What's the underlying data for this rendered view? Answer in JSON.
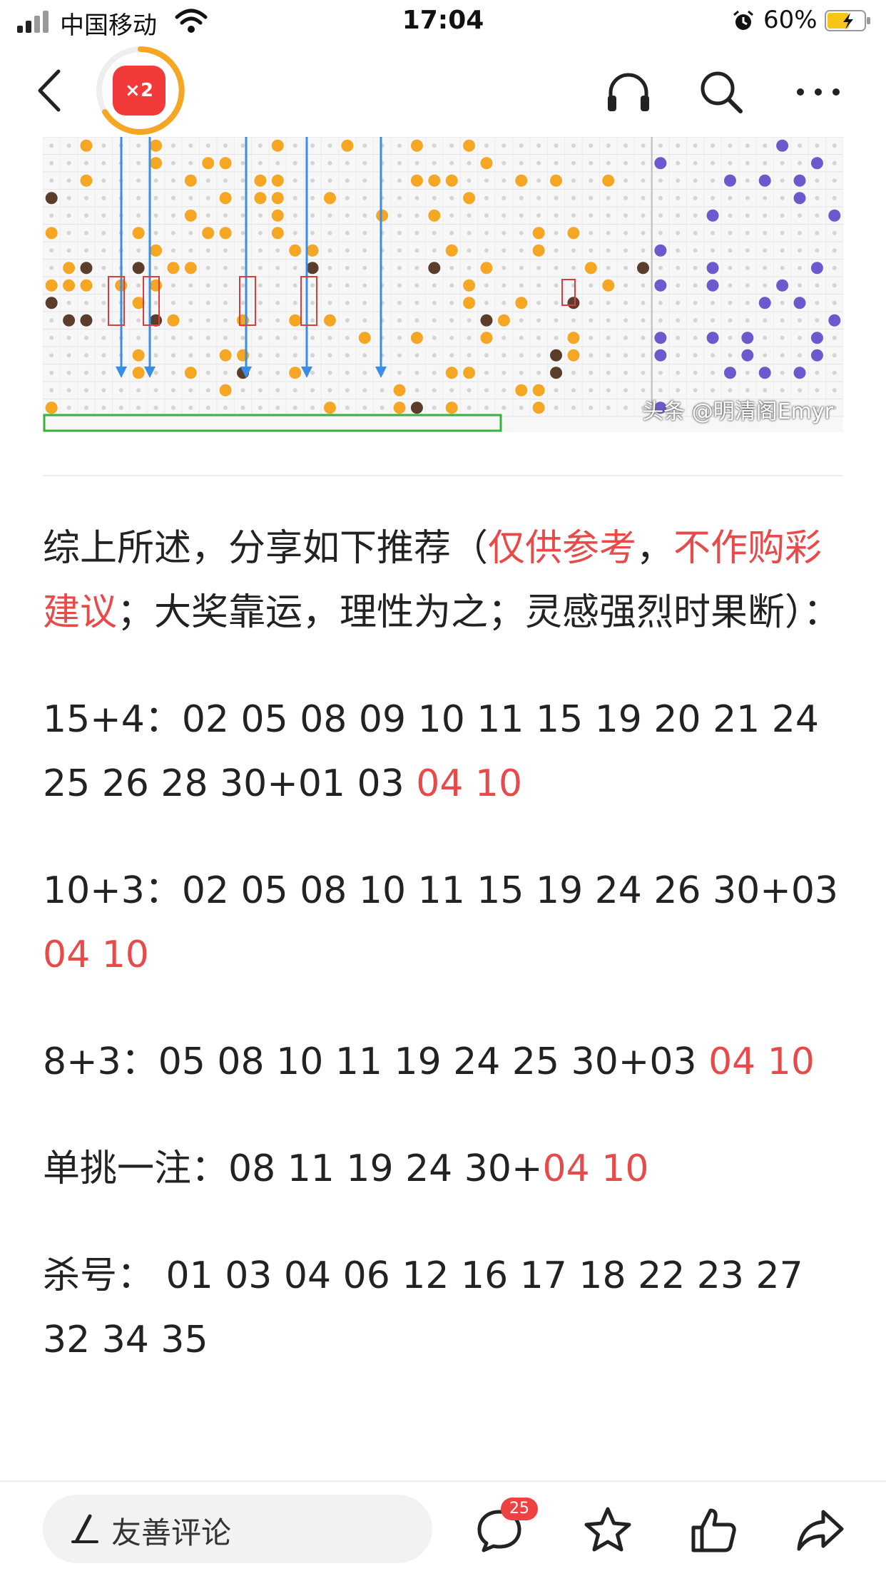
{
  "status_bar": {
    "carrier": "中国移动",
    "time": "17:04",
    "battery_percent": "60%",
    "battery_level": 0.6
  },
  "nav": {
    "badge_text": "×2",
    "icons": [
      "back-icon",
      "headphones-icon",
      "search-icon",
      "more-icon"
    ]
  },
  "image": {
    "watermark": "头条 @明清阁Emyr"
  },
  "article": {
    "intro_prefix": "综上所述，分享如下推荐（",
    "intro_red1": "仅供参考",
    "intro_comma": "，",
    "intro_red2": "不作购彩建议",
    "intro_suffix": "；大奖靠运，理性为之；灵感强烈时果断）：",
    "rec1_main": "15+4：02 05 08 09 10 11 15 19 20 21 24 25 26 28 30+01 03 ",
    "rec1_red": "04 10",
    "rec2_main": "10+3：02 05 08 10 11 15 19 24 26 30+03 ",
    "rec2_red": "04 10",
    "rec3_main": "8+3：05 08 10 11 19 24 25 30+03 ",
    "rec3_red": "04 10",
    "rec4_main": "单挑一注：08 11 19 24 30+",
    "rec4_red": "04 10",
    "kill_line": "杀号： 01 03 04 06 12 16 17 18 22 23 27 32 34 35"
  },
  "bottom_bar": {
    "comment_placeholder": "友善评论",
    "comment_count": "25",
    "icons": [
      "pen-icon",
      "comment-icon",
      "star-icon",
      "thumbs-up-icon",
      "share-icon"
    ]
  },
  "colors": {
    "red_text": "#e84a4a",
    "orange_ball": "#f5a623",
    "blue_ball": "#6a5acd",
    "badge_red": "#f04142"
  }
}
